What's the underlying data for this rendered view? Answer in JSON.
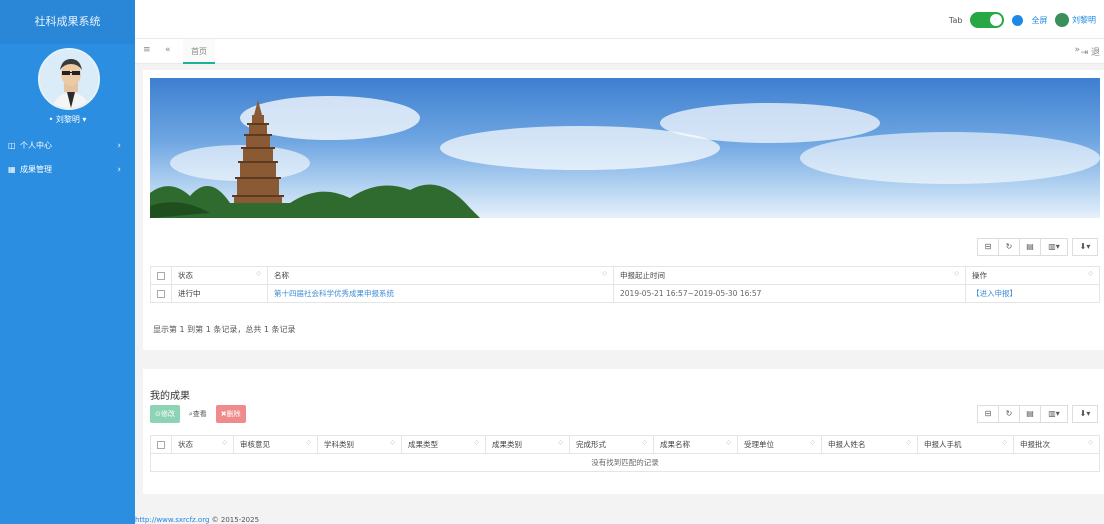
{
  "app": {
    "title": "社科成果系统"
  },
  "user": {
    "name": "刘黎明",
    "name_with_caret": "• 刘黎明 ▾"
  },
  "sidebar": {
    "items": [
      {
        "label": "个人中心",
        "icon": "id-card-icon"
      },
      {
        "label": "成果管理",
        "icon": "grid-icon"
      }
    ]
  },
  "topbar": {
    "tab_label": "Tab",
    "fullscreen_label": "全屏",
    "user_label": "刘黎明"
  },
  "tabs": {
    "home_label": "首页",
    "close_label": "退"
  },
  "apply_table": {
    "columns": [
      "状态",
      "名称",
      "申报起止时间",
      "操作"
    ],
    "rows": [
      {
        "status": "进行中",
        "name": "第十四届社会科学优秀成果申报系统",
        "period": "2019-05-21 16:57~2019-05-30 16:57",
        "action": "【进入申报】"
      }
    ],
    "pagination": "显示第 1 到第 1 条记录，总共 1 条记录"
  },
  "my_results": {
    "title": "我的成果",
    "buttons": {
      "edit": "修改",
      "view": "查看",
      "delete": "删除"
    },
    "columns": [
      "状态",
      "审核意见",
      "学科类别",
      "成果类型",
      "成果类别",
      "完成形式",
      "成果名称",
      "受理单位",
      "申报人姓名",
      "申报人手机",
      "申报批次"
    ],
    "empty": "没有找到匹配的记录"
  },
  "footer": {
    "url": "http://www.sxrcfz.org",
    "copyright": "© 2015-2025"
  },
  "colors": {
    "sidebar": "#2b8ee0",
    "accent_green": "#28a745",
    "link": "#1e88e5"
  }
}
